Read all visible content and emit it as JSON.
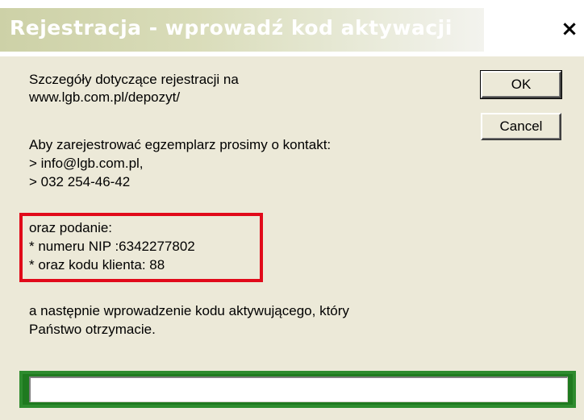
{
  "dialog": {
    "title": "Rejestracja - wprowadź kod aktywacji",
    "close_label": "×",
    "buttons": {
      "ok_label": "OK",
      "cancel_label": "Cancel"
    },
    "details": {
      "line1": "Szczegóły dotyczące rejestracji na",
      "line2": "www.lgb.com.pl/depozyt/"
    },
    "contact": {
      "line1": "Aby zarejestrować egzemplarz prosimy o kontakt:",
      "line2": "> info@lgb.com.pl,",
      "line3": "> 032 254-46-42"
    },
    "required_info": {
      "line1": "oraz podanie:",
      "line2": "* numeru NIP :6342277802",
      "line3": "* oraz kodu klienta: 88"
    },
    "instructions": {
      "line1": "a następnie wprowadzenie kodu aktywującego, który",
      "line2": "Państwo otrzymacie."
    },
    "activation_input": {
      "value": "",
      "placeholder": ""
    },
    "colors": {
      "highlight_red": "#e10a1a",
      "highlight_green": "#2e8b2e",
      "dialog_bg": "#ece9d8"
    }
  }
}
